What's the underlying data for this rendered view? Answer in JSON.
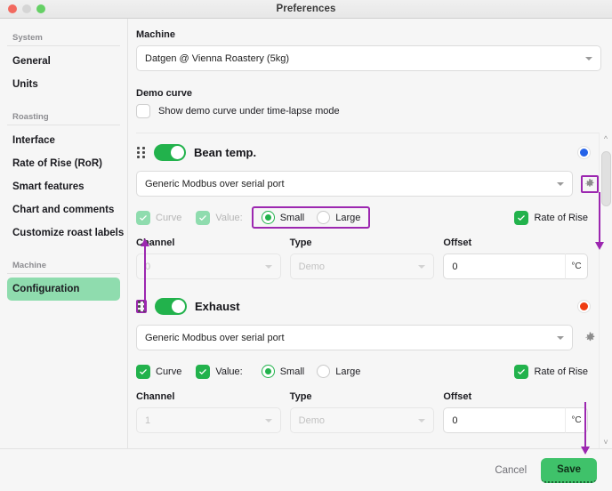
{
  "window": {
    "title": "Preferences",
    "traffic_lights": [
      "close-red",
      "minimize-gray",
      "zoom-green"
    ]
  },
  "sidebar": {
    "groups": [
      {
        "label": "System",
        "items": [
          {
            "label": "General",
            "active": false
          },
          {
            "label": "Units",
            "active": false
          }
        ]
      },
      {
        "label": "Roasting",
        "items": [
          {
            "label": "Interface",
            "active": false
          },
          {
            "label": "Rate of Rise (RoR)",
            "active": false
          },
          {
            "label": "Smart features",
            "active": false
          },
          {
            "label": "Chart and comments",
            "active": false
          },
          {
            "label": "Customize roast labels",
            "active": false
          }
        ]
      },
      {
        "label": "Machine",
        "items": [
          {
            "label": "Configuration",
            "active": true
          }
        ]
      }
    ]
  },
  "main": {
    "machine": {
      "label": "Machine",
      "value": "Datgen @ Vienna Roastery (5kg)"
    },
    "demo_curve": {
      "label": "Demo curve",
      "checkbox_label": "Show demo curve under time-lapse mode",
      "checked": false
    },
    "devices": [
      {
        "name": "Bean temp.",
        "enabled": true,
        "status_color": "#2563e8",
        "source": "Generic Modbus over serial port",
        "curve": {
          "label": "Curve",
          "checked": true,
          "disabled": true
        },
        "value": {
          "label": "Value:",
          "checked": true,
          "disabled": true
        },
        "size": {
          "selected": "Small",
          "options": [
            "Small",
            "Large"
          ]
        },
        "rate_of_rise": {
          "label": "Rate of Rise",
          "checked": true,
          "disabled": false
        },
        "channel": {
          "label": "Channel",
          "value": "0",
          "disabled": true
        },
        "type": {
          "label": "Type",
          "value": "Demo",
          "disabled": true
        },
        "offset": {
          "label": "Offset",
          "value": "0",
          "unit": "°C"
        }
      },
      {
        "name": "Exhaust",
        "enabled": true,
        "status_color": "#ef3c12",
        "source": "Generic Modbus over serial port",
        "curve": {
          "label": "Curve",
          "checked": true,
          "disabled": false
        },
        "value": {
          "label": "Value:",
          "checked": true,
          "disabled": false
        },
        "size": {
          "selected": "Small",
          "options": [
            "Small",
            "Large"
          ]
        },
        "rate_of_rise": {
          "label": "Rate of Rise",
          "checked": true,
          "disabled": false
        },
        "channel": {
          "label": "Channel",
          "value": "1",
          "disabled": true
        },
        "type": {
          "label": "Type",
          "value": "Demo",
          "disabled": true
        },
        "offset": {
          "label": "Offset",
          "value": "0",
          "unit": "°C"
        }
      }
    ]
  },
  "footer": {
    "cancel_label": "Cancel",
    "save_label": "Save"
  },
  "annotations": {
    "accent_color": "#9c27b0"
  }
}
